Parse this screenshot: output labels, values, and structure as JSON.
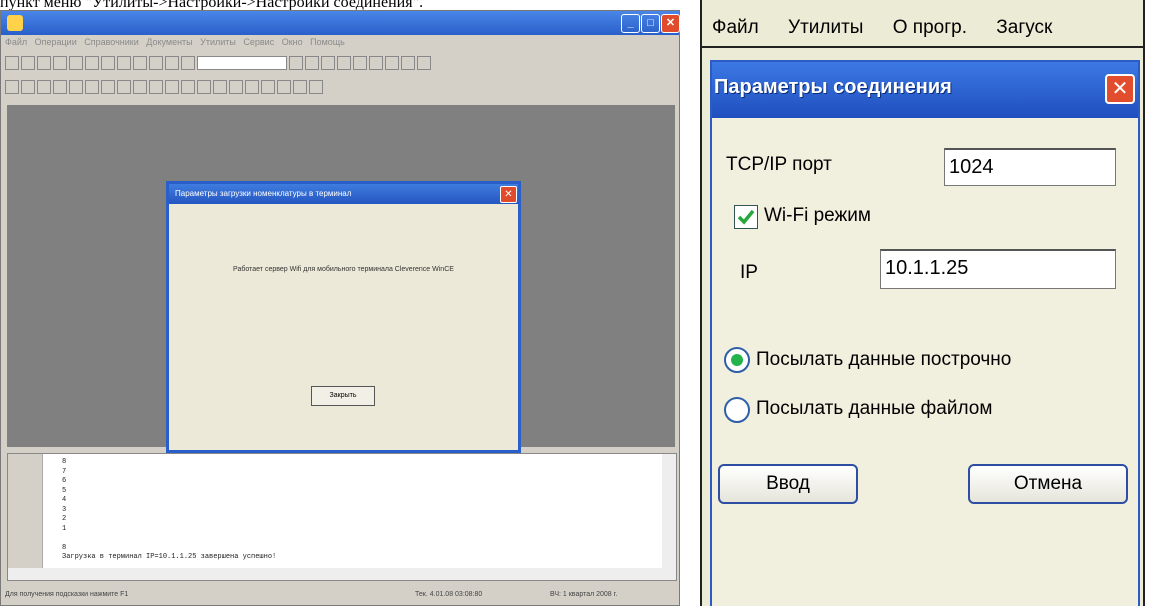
{
  "caption": "пункт меню \"Утилиты->Настройки->Настройки соединения\".",
  "desktop": {
    "menu_text": "Файл Операции Справочники Документы Утилиты Сервис Окно Помощь",
    "dialog": {
      "title": "Параметры загрузки номенклатуры в терминал",
      "message": "Работает сервер Wifi для мобильного терминала Cleverence WinCE",
      "close_button": "Закрыть"
    },
    "log": {
      "lines": [
        "8",
        "7",
        "6",
        "5",
        "4",
        "3",
        "2",
        "1",
        "",
        "8",
        "Загрузка в терминал IP=10.1.1.25 завершена успешно!"
      ]
    },
    "status": {
      "left": "Для получения подсказки нажмите F1",
      "center": "Тек. 4.01.08 03:08:80",
      "right": "ВЧ: 1 квартал 2008 г."
    }
  },
  "pda": {
    "menu": [
      "Файл",
      "Утилиты",
      "О прогр.",
      "Загуск"
    ],
    "dialog": {
      "title": "Параметры соединения",
      "tcp_label": "TCP/IP порт",
      "tcp_value": "1024",
      "wifi_label": "Wi-Fi режим",
      "wifi_checked": true,
      "ip_label": "IP",
      "ip_value": "10.1.1.25",
      "radio_line_label": "Посылать данные построчно",
      "radio_file_label": "Посылать данные файлом",
      "radio_selected": "line",
      "ok_button": "Ввод",
      "cancel_button": "Отмена"
    }
  },
  "colors": {
    "xp_title_blue": "#2a5fc9",
    "close_red": "#e24e2d",
    "pda_background": "#ecebd6",
    "radio_green": "#23b34a",
    "check_green": "#27a83a"
  }
}
